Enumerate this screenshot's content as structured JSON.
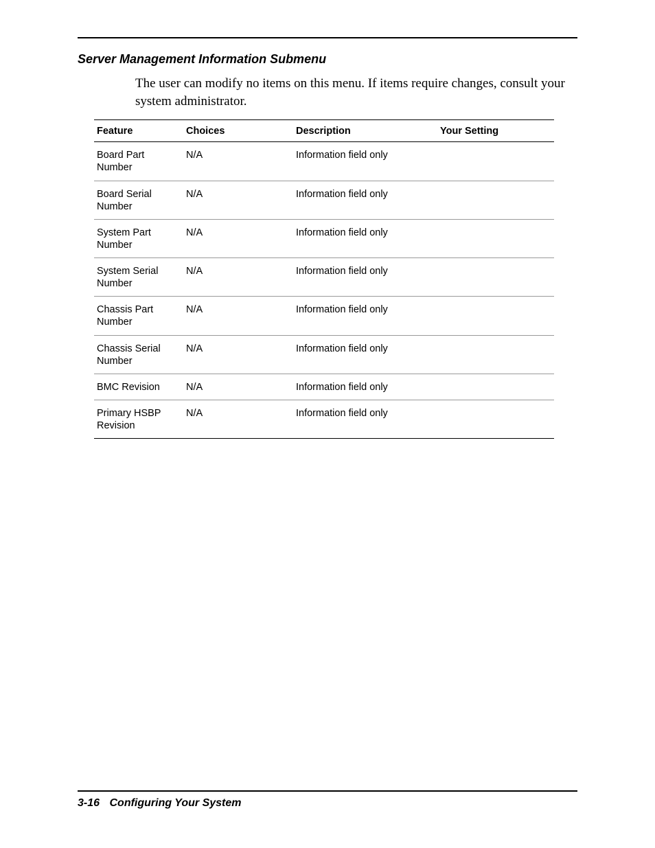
{
  "section_title": "Server Management Information Submenu",
  "intro_text": "The user can modify no items on this menu. If items require changes, consult your system administrator.",
  "table": {
    "headers": {
      "feature": "Feature",
      "choices": "Choices",
      "description": "Description",
      "setting": "Your Setting"
    },
    "rows": [
      {
        "feature": "Board Part Number",
        "choices": "N/A",
        "description": "Information field only",
        "setting": ""
      },
      {
        "feature": "Board Serial Number",
        "choices": "N/A",
        "description": "Information field only",
        "setting": ""
      },
      {
        "feature": "System Part Number",
        "choices": "N/A",
        "description": "Information field only",
        "setting": ""
      },
      {
        "feature": "System Serial Number",
        "choices": "N/A",
        "description": "Information field only",
        "setting": ""
      },
      {
        "feature": "Chassis Part Number",
        "choices": "N/A",
        "description": "Information field only",
        "setting": ""
      },
      {
        "feature": "Chassis Serial Number",
        "choices": "N/A",
        "description": "Information field only",
        "setting": ""
      },
      {
        "feature": "BMC Revision",
        "choices": "N/A",
        "description": "Information field only",
        "setting": ""
      },
      {
        "feature": "Primary HSBP Revision",
        "choices": "N/A",
        "description": "Information field only",
        "setting": ""
      }
    ]
  },
  "footer": {
    "page_number": "3-16",
    "chapter_title": "Configuring Your System"
  }
}
